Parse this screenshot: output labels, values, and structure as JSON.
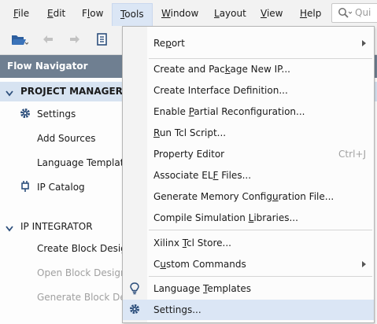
{
  "menubar": {
    "items": [
      {
        "label": "File",
        "underline": "F"
      },
      {
        "label": "Edit",
        "underline": "E"
      },
      {
        "label": "Flow",
        "underline": "l"
      },
      {
        "label": "Tools",
        "underline": "T"
      },
      {
        "label": "Window",
        "underline": "W"
      },
      {
        "label": "Layout",
        "underline": "L"
      },
      {
        "label": "View",
        "underline": "V"
      },
      {
        "label": "Help",
        "underline": "H"
      }
    ],
    "search_placeholder": "Qui"
  },
  "toolbar": {
    "icons": [
      "open-project-icon",
      "undo-icon",
      "redo-icon",
      "document-icon"
    ]
  },
  "flow_navigator": {
    "title": "Flow Navigator",
    "project_manager": {
      "label": "PROJECT MANAGER",
      "items": [
        "Settings",
        "Add Sources",
        "Language Template",
        "IP Catalog"
      ]
    },
    "ip_integrator": {
      "label": "IP INTEGRATOR",
      "items": [
        "Create Block Desig",
        "Open Block Design",
        "Generate Block Des"
      ]
    }
  },
  "tools_menu": {
    "items": [
      {
        "label": "Report",
        "u": "p",
        "submenu": true
      },
      {
        "label": "Create and Package New IP...",
        "u": "k"
      },
      {
        "label": "Create Interface Definition..."
      },
      {
        "label": "Enable Partial Reconfiguration...",
        "u": "P"
      },
      {
        "label": "Run Tcl Script...",
        "u": "R"
      },
      {
        "label": "Property Editor",
        "shortcut": "Ctrl+J"
      },
      {
        "label": "Associate ELF Files...",
        "u": "F"
      },
      {
        "label": "Generate Memory Configuration File...",
        "u": "u"
      },
      {
        "label": "Compile Simulation Libraries...",
        "u": "L"
      },
      {
        "label": "Xilinx Tcl Store...",
        "u": "T"
      },
      {
        "label": "Custom Commands",
        "u": "u",
        "submenu": true
      },
      {
        "label": "Language Templates",
        "u": "T"
      },
      {
        "label": "Settings..."
      }
    ]
  },
  "colors": {
    "nav_header": "#6f7f91",
    "highlight": "#dbe6f5",
    "accent": "#2d5e9e"
  }
}
